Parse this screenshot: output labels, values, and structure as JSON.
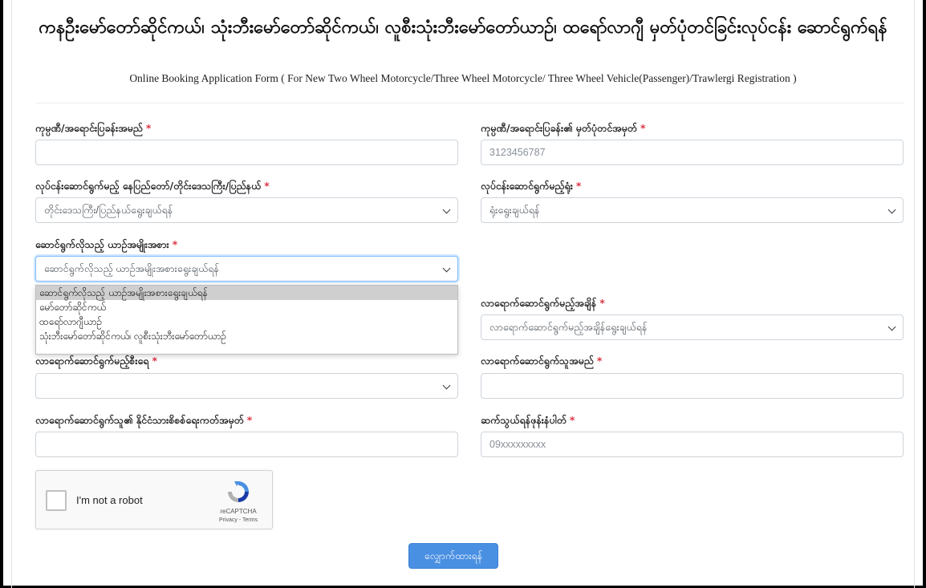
{
  "header": {
    "title_mm": "ကနဦးမော်တော်ဆိုင်ကယ်၊ သုံးဘီးမော်တော်ဆိုင်ကယ်၊ လူစီးသုံးဘီးမော်တော်ယာဉ်၊ ထရော်လာဂျီ မှတ်ပုံတင်ခြင်းလုပ်ငန်း ဆောင်ရွက်ရန်",
    "title_en": "Online Booking Application Form ( For New Two Wheel Motorcycle/Three Wheel Motorcycle/ Three Wheel Vehicle(Passenger)/Trawlergi Registration )"
  },
  "form": {
    "required_mark": "*",
    "company_name": {
      "label": "ကုမ္ပဏီ/အရောင်းပြခန်းအမည်",
      "value": "",
      "placeholder": ""
    },
    "company_reg_no": {
      "label": "ကုမ္ပဏီ/အရောင်းပြခန်း၏ မှတ်ပုံတင်အမှတ်",
      "value": "",
      "placeholder": "3123456787"
    },
    "region": {
      "label": "လုပ်ငန်းဆောင်ရွက်မည့် နေပြည်တော်/တိုင်းဒေသကြီး/ပြည်နယ်",
      "selected": "တိုင်းဒေသကြီး/ပြည်နယ်ရွေးချယ်ရန်"
    },
    "office": {
      "label": "လုပ်ငန်းဆောင်ရွက်မည့်ရုံး",
      "selected": "ရုံးရွေးချယ်ရန်"
    },
    "vehicle_type": {
      "label": "ဆောင်ရွက်လိုသည့် ယာဉ်အမျိုးအစား",
      "selected": "ဆောင်ရွက်လိုသည့် ယာဉ်အမျိုးအစားရွေးချယ်ရန်",
      "options": [
        "ဆောင်ရွက်လိုသည့် ယာဉ်အမျိုးအစားရွေးချယ်ရန်",
        "မော်တော်ဆိုင်ကယ်",
        "ထရော်လာဂျီယာဉ်",
        "သုံးဘီးမော်တော်ဆိုင်ကယ်၊ လူစီးသုံးဘီးမော်တော်ယာဉ်"
      ]
    },
    "visit_time": {
      "label": "လာရောက်ဆောင်ရွက်မည့်အချိန်",
      "selected": "လာရောက်ဆောင်ရွက်မည့်အချိန်ရွေးချယ်ရန်"
    },
    "visit_count": {
      "label": "လာရောက်ဆောင်ရွက်မည့်စီးရေ",
      "selected": ""
    },
    "visitor_name": {
      "label": "လာရောက်ဆောင်ရွက်သူအမည်",
      "value": "",
      "placeholder": ""
    },
    "visitor_nrc": {
      "label": "လာရောက်ဆောင်ရွက်သူ၏ နိုင်ငံသားစိစစ်ရေးကတ်အမှတ်",
      "value": "",
      "placeholder": ""
    },
    "phone": {
      "label": "ဆက်သွယ်ရန်ဖုန်းနံပါတ်",
      "value": "",
      "placeholder": "09xxxxxxxxx"
    }
  },
  "recaptcha": {
    "label": "I'm not a robot",
    "brand": "reCAPTCHA",
    "links": "Privacy - Terms"
  },
  "submit": {
    "label": "လျှောက်ထားရန်"
  },
  "colors": {
    "accent": "#4a90e2",
    "required": "#dc3545",
    "border": "#ced4da"
  }
}
